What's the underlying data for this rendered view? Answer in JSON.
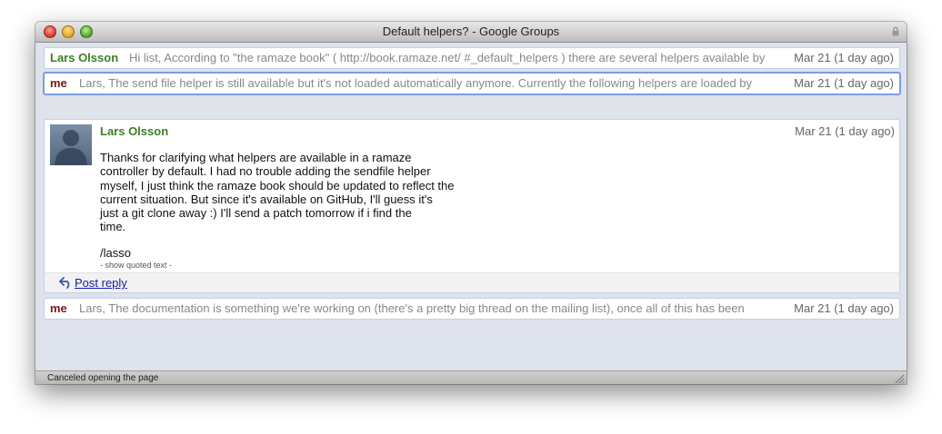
{
  "window": {
    "title": "Default helpers? - Google Groups"
  },
  "messages": [
    {
      "author": "Lars Olsson",
      "snippet": "Hi list, According to \"the ramaze book\" ( http://book.ramaze.net/ #_default_helpers ) there are several helpers available by",
      "date": "Mar 21 (1 day ago)"
    },
    {
      "author": "me",
      "snippet": "Lars, The send file helper is still available but it's not loaded automatically anymore. Currently the following helpers are loaded by",
      "date": "Mar 21 (1 day ago)"
    },
    {
      "author": "me",
      "snippet": "Lars, The documentation is something we're working on (there's a pretty big thread on the mailing list), once all of this has been",
      "date": "Mar 21 (1 day ago)"
    }
  ],
  "expanded_message": {
    "author": "Lars Olsson",
    "date": "Mar 21 (1 day ago)",
    "body": "Thanks for clarifying what helpers are available in a ramaze\ncontroller by default. I had no trouble adding the sendfile helper\nmyself, I just think the ramaze book should be updated to reflect the\ncurrent situation. But since it's available on GitHub, I'll guess it's\njust a git clone away :) I'll send a patch tomorrow if i find the\ntime.",
    "signature": "/lasso",
    "show_quoted": "- show quoted text -",
    "reply_label": "Post reply"
  },
  "statusbar": {
    "text": "Canceled opening the page"
  },
  "colors": {
    "author_green": "#3c7e25",
    "author_me": "#7a1a1a",
    "link_blue": "#1a1aa8",
    "selected_border": "#7b9de0"
  },
  "icons": [
    "close-icon",
    "minimize-icon",
    "zoom-icon",
    "lock-icon",
    "reply-arrow-icon",
    "resize-grip-icon"
  ]
}
